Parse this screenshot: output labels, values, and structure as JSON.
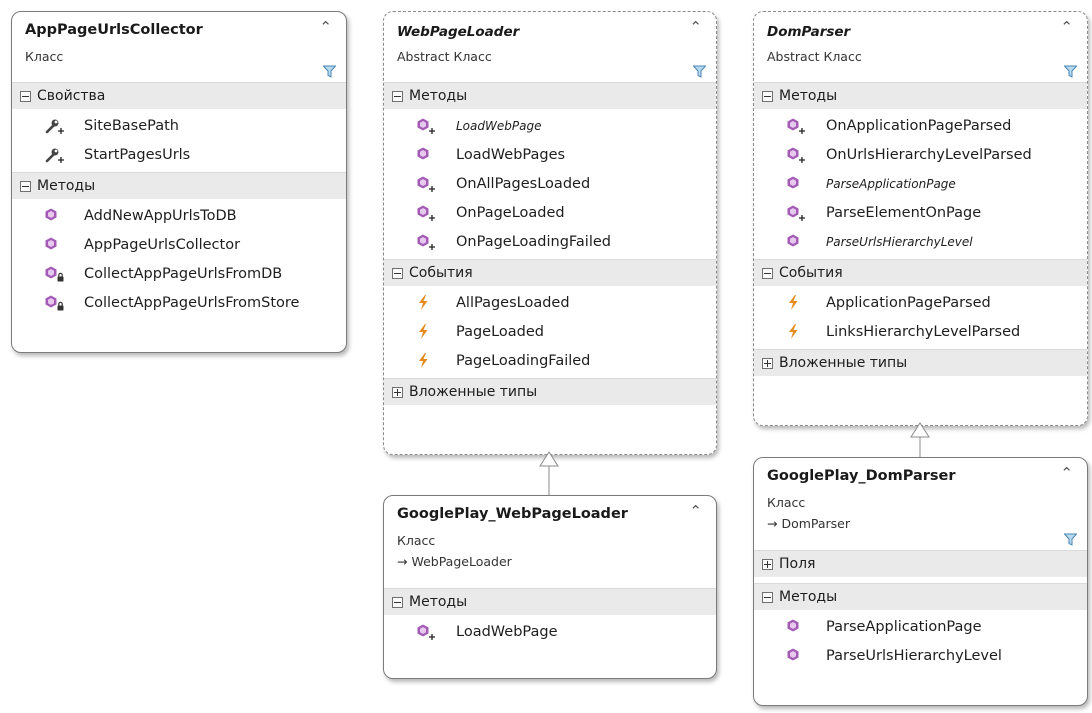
{
  "colors": {
    "method": "#a35bb5",
    "event": "#e58a1f",
    "property": "#444444",
    "border": "#7b7b7b",
    "section_bg": "#eaeaea"
  },
  "boxes": {
    "app_collector": {
      "title": "AppPageUrlsCollector",
      "kind": "Класс",
      "properties_header": "Свойства",
      "properties": [
        {
          "label": "SiteBasePath",
          "icon": "property-protected-icon"
        },
        {
          "label": "StartPagesUrls",
          "icon": "property-protected-icon"
        }
      ],
      "methods_header": "Методы",
      "methods": [
        {
          "label": "AddNewAppUrlsToDB",
          "icon": "method-icon"
        },
        {
          "label": "AppPageUrlsCollector",
          "icon": "method-icon"
        },
        {
          "label": "CollectAppPageUrlsFromDB",
          "icon": "method-private-icon"
        },
        {
          "label": "CollectAppPageUrlsFromStore",
          "icon": "method-private-icon"
        }
      ]
    },
    "web_page_loader": {
      "title": "WebPageLoader",
      "kind": "Abstract Класс",
      "methods_header": "Методы",
      "methods": [
        {
          "label": "LoadWebPage",
          "icon": "method-protected-icon",
          "italic": true
        },
        {
          "label": "LoadWebPages",
          "icon": "method-icon"
        },
        {
          "label": "OnAllPagesLoaded",
          "icon": "method-protected-icon"
        },
        {
          "label": "OnPageLoaded",
          "icon": "method-protected-icon"
        },
        {
          "label": "OnPageLoadingFailed",
          "icon": "method-protected-icon"
        }
      ],
      "events_header": "События",
      "events": [
        {
          "label": "AllPagesLoaded",
          "icon": "event-icon"
        },
        {
          "label": "PageLoaded",
          "icon": "event-icon"
        },
        {
          "label": "PageLoadingFailed",
          "icon": "event-icon"
        }
      ],
      "nested_header": "Вложенные типы"
    },
    "dom_parser": {
      "title": "DomParser",
      "kind": "Abstract Класс",
      "methods_header": "Методы",
      "methods": [
        {
          "label": "OnApplicationPageParsed",
          "icon": "method-protected-icon"
        },
        {
          "label": "OnUrlsHierarchyLevelParsed",
          "icon": "method-protected-icon"
        },
        {
          "label": "ParseApplicationPage",
          "icon": "method-icon",
          "italic": true
        },
        {
          "label": "ParseElementOnPage",
          "icon": "method-protected-icon"
        },
        {
          "label": "ParseUrlsHierarchyLevel",
          "icon": "method-icon",
          "italic": true
        }
      ],
      "events_header": "События",
      "events": [
        {
          "label": "ApplicationPageParsed",
          "icon": "event-icon"
        },
        {
          "label": "LinksHierarchyLevelParsed",
          "icon": "event-icon"
        }
      ],
      "nested_header": "Вложенные типы"
    },
    "gp_loader": {
      "title": "GooglePlay_WebPageLoader",
      "kind": "Класс",
      "base": "→ WebPageLoader",
      "methods_header": "Методы",
      "methods": [
        {
          "label": "LoadWebPage",
          "icon": "method-protected-icon"
        }
      ]
    },
    "gp_parser": {
      "title": "GooglePlay_DomParser",
      "kind": "Класс",
      "base": "→ DomParser",
      "fields_header": "Поля",
      "methods_header": "Методы",
      "methods": [
        {
          "label": "ParseApplicationPage",
          "icon": "method-icon"
        },
        {
          "label": "ParseUrlsHierarchyLevel",
          "icon": "method-icon"
        }
      ]
    }
  }
}
